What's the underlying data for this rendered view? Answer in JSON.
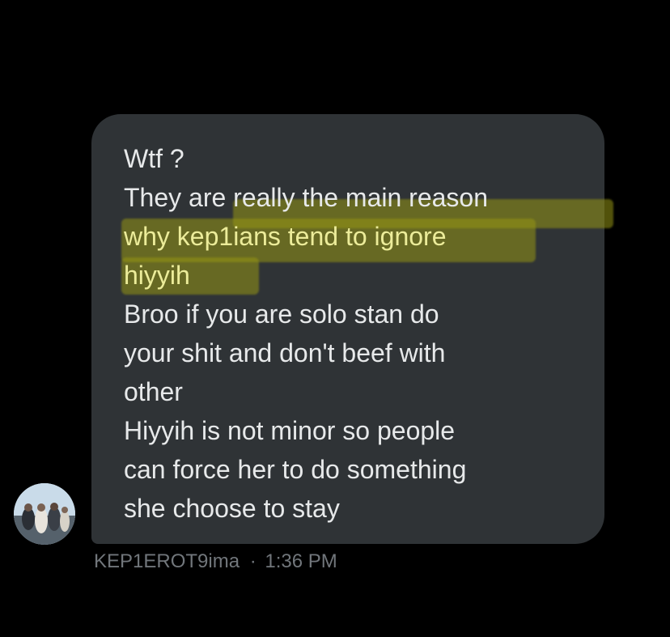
{
  "message": {
    "lines": [
      "Wtf ?",
      "They are really the main reason",
      "why kep1ians tend to ignore",
      "hiyyih",
      "Broo if you are solo stan do",
      "your shit and don't beef with",
      "other",
      "Hiyyih is not minor so people",
      "can force her to do something",
      "she choose to stay"
    ],
    "highlight_color": "#a5a51e"
  },
  "sender": {
    "username": "KEP1EROT9ima",
    "separator": "·",
    "time": "1:36 PM"
  },
  "colors": {
    "background": "#000000",
    "bubble": "#2f3336",
    "text": "#e7e9ea",
    "meta_text": "#71767b"
  }
}
